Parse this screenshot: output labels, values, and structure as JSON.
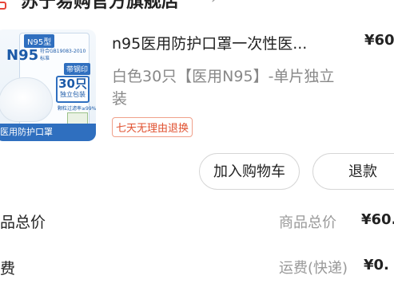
{
  "store": {
    "name": "苏宁易购官方旗舰店",
    "chevron_icon": "chevron-right-icon",
    "store_icon": "store-icon"
  },
  "product": {
    "image": {
      "tag": "N95型",
      "brand": "N95",
      "standard": "符合GB19083-2010标准",
      "band": "带钢印",
      "count_big": "30只",
      "count_sub": "独立包装",
      "filter": "颗粒过滤率≥99%",
      "bottom_text": "医用防护口罩"
    },
    "title": "n95医用防护口罩一次性医...",
    "price": "¥60",
    "spec": "白色30只【医用N95】-单片独立装",
    "badge": "七天无理由退换"
  },
  "actions": {
    "add_cart": "加入购物车",
    "refund": "退款"
  },
  "summary": {
    "goods": {
      "label": "品总价",
      "name": "商品总价",
      "value": "¥60."
    },
    "shipping": {
      "label": "费",
      "name": "运费(快递)",
      "value": "¥0."
    }
  },
  "colors": {
    "accent": "#e0502f",
    "brand_blue": "#2f6fbf"
  }
}
